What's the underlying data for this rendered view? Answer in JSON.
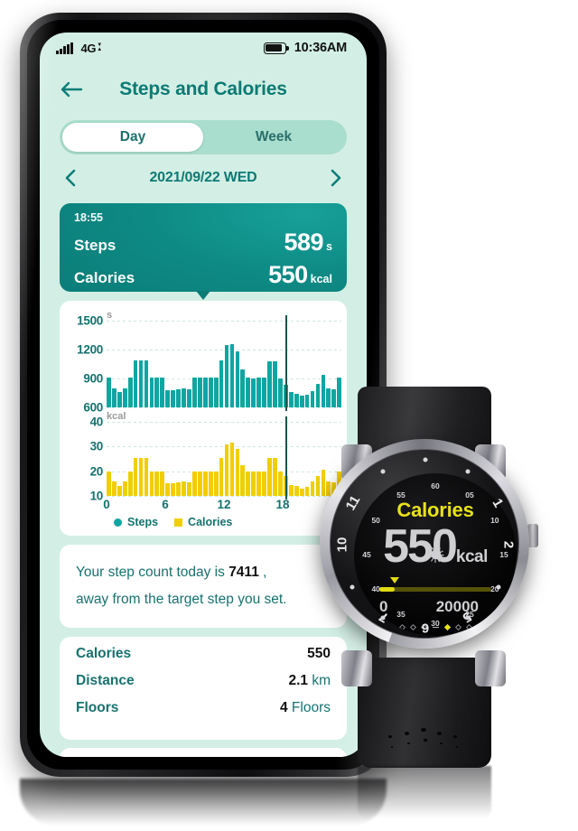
{
  "statusbar": {
    "network": "4G",
    "time": "10:36AM",
    "signal_icon": "signal-bars-icon",
    "battery_icon": "battery-full-icon"
  },
  "header": {
    "title": "Steps and Calories",
    "back_icon": "back-arrow-icon"
  },
  "segment": {
    "day": "Day",
    "week": "Week",
    "active": "Day"
  },
  "date_nav": {
    "prev_icon": "chevron-left-icon",
    "next_icon": "chevron-right-icon",
    "label": "2021/09/22 WED"
  },
  "tooltip_card": {
    "time": "18:55",
    "steps_label": "Steps",
    "steps_value": "589",
    "steps_unit": "s",
    "calories_label": "Calories",
    "calories_value": "550",
    "calories_unit": "kcal"
  },
  "message": {
    "prefix": "Your step count today is ",
    "count": "7411",
    "suffix": " ,",
    "line2": "away from the target step you set."
  },
  "stats": {
    "rows": [
      {
        "key": "Calories",
        "value": "550",
        "unit": ""
      },
      {
        "key": "Distance",
        "value": "2.1",
        "unit": " km"
      },
      {
        "key": "Floors",
        "value": "4",
        "unit": " Floors"
      }
    ]
  },
  "watch": {
    "title": "Calories",
    "value": "550",
    "unit": "kcal",
    "range_min": "0",
    "range_max": "20000",
    "progress_pct": 14,
    "bezel_numbers": [
      "11",
      "1",
      "10",
      "2",
      "7",
      "5",
      "6"
    ],
    "minute_numbers": [
      "60",
      "05",
      "10",
      "15",
      "20",
      "25",
      "30",
      "35",
      "40",
      "45",
      "50",
      "55"
    ],
    "pager_dots": 11,
    "pager_active_index": 6,
    "pager_dash_index": 5,
    "accent_color": "#e8e21a"
  },
  "chart_data": {
    "type": "bar",
    "title": "Steps and Calories",
    "xlabel": "",
    "x_ticks": [
      "0",
      "6",
      "12",
      "18"
    ],
    "x_tick_positions": [
      0,
      6,
      12,
      18
    ],
    "xlim": [
      0,
      24
    ],
    "grid": true,
    "legend": [
      {
        "name": "Steps",
        "color": "#0fa6a2",
        "marker": "circle"
      },
      {
        "name": "Calories",
        "color": "#f0ce00",
        "marker": "square"
      }
    ],
    "cursor_x_hour": 18.3,
    "panels": [
      {
        "name": "Steps",
        "ylabel": "s",
        "ylim": [
          600,
          1500
        ],
        "y_ticks": [
          600,
          900,
          1200,
          1500
        ],
        "color": "#0fa6a2",
        "values": [
          910,
          800,
          760,
          800,
          910,
          1090,
          1090,
          1090,
          910,
          910,
          910,
          780,
          780,
          790,
          800,
          790,
          910,
          910,
          910,
          910,
          910,
          1090,
          1250,
          1260,
          1180,
          990,
          905,
          900,
          905,
          910,
          1080,
          1080,
          900,
          830,
          760,
          740,
          720,
          730,
          770,
          840,
          940,
          800,
          790,
          910
        ]
      },
      {
        "name": "Calories",
        "ylabel": "kcal",
        "ylim": [
          10,
          40
        ],
        "y_ticks": [
          10,
          20,
          30,
          40
        ],
        "color": "#f0ce00",
        "values": [
          20,
          16,
          14,
          16,
          20,
          25.5,
          25.5,
          25.5,
          20,
          20,
          20,
          15,
          15,
          15.5,
          16,
          15.5,
          20,
          20,
          20,
          20,
          20,
          25.5,
          31,
          31.5,
          29,
          22.5,
          20,
          20,
          20,
          20,
          25.5,
          25.5,
          20,
          18,
          14.5,
          14,
          13,
          13.5,
          16,
          18,
          20.5,
          16,
          15.5,
          20
        ]
      }
    ]
  }
}
